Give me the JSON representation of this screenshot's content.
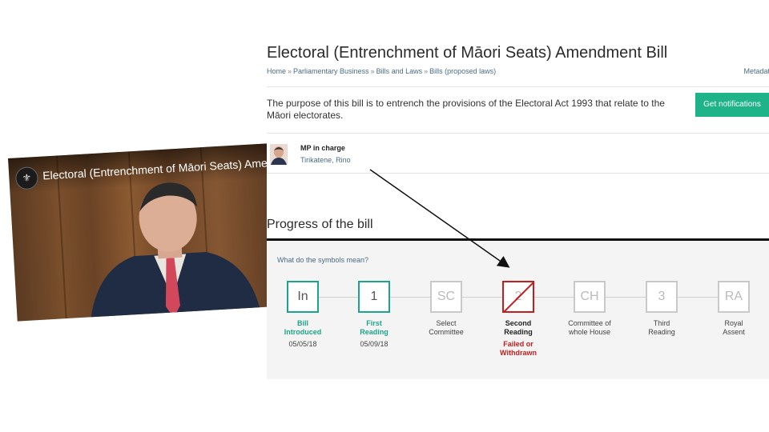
{
  "video": {
    "title": "Electoral (Entrenchment of Māori Seats) Amendment Bill",
    "crest_icon": "parliament-crest-icon"
  },
  "page": {
    "title": "Electoral (Entrenchment of Māori Seats) Amendment Bill",
    "breadcrumb": [
      "Home",
      "Parliamentary Business",
      "Bills and Laws",
      "Bills (proposed laws)"
    ],
    "breadcrumb_separator": "»",
    "metadata_link": "Metadata",
    "purpose": "The purpose of this bill is to entrench the provisions of the Electoral Act 1993 that relate to the Māori electorates.",
    "notify_button": "Get notifications",
    "mp": {
      "label": "MP in charge",
      "name": "Tirikatene, Rino"
    },
    "progress": {
      "heading": "Progress of the bill",
      "symbols_link": "What do the symbols mean?",
      "stages": [
        {
          "abbr": "In",
          "label_1": "Bill",
          "label_2": "Introduced",
          "date": "05/05/18",
          "state": "done",
          "status_1": "",
          "status_2": ""
        },
        {
          "abbr": "1",
          "label_1": "First",
          "label_2": "Reading",
          "date": "05/09/18",
          "state": "done",
          "status_1": "",
          "status_2": ""
        },
        {
          "abbr": "SC",
          "label_1": "Select",
          "label_2": "Committee",
          "date": "",
          "state": "pending",
          "status_1": "",
          "status_2": ""
        },
        {
          "abbr": "2",
          "label_1": "Second",
          "label_2": "Reading",
          "date": "",
          "state": "failed",
          "status_1": "Failed or",
          "status_2": "Withdrawn"
        },
        {
          "abbr": "CH",
          "label_1": "Committee of",
          "label_2": "whole House",
          "date": "",
          "state": "pending",
          "status_1": "",
          "status_2": ""
        },
        {
          "abbr": "3",
          "label_1": "Third",
          "label_2": "Reading",
          "date": "",
          "state": "pending",
          "status_1": "",
          "status_2": ""
        },
        {
          "abbr": "RA",
          "label_1": "Royal",
          "label_2": "Assent",
          "date": "",
          "state": "pending",
          "status_1": "",
          "status_2": ""
        }
      ]
    }
  },
  "colors": {
    "accent_green": "#1aa58a",
    "button_green": "#1fb38a",
    "failed_red": "#c31d1d",
    "link_blue": "#4a6b87"
  }
}
